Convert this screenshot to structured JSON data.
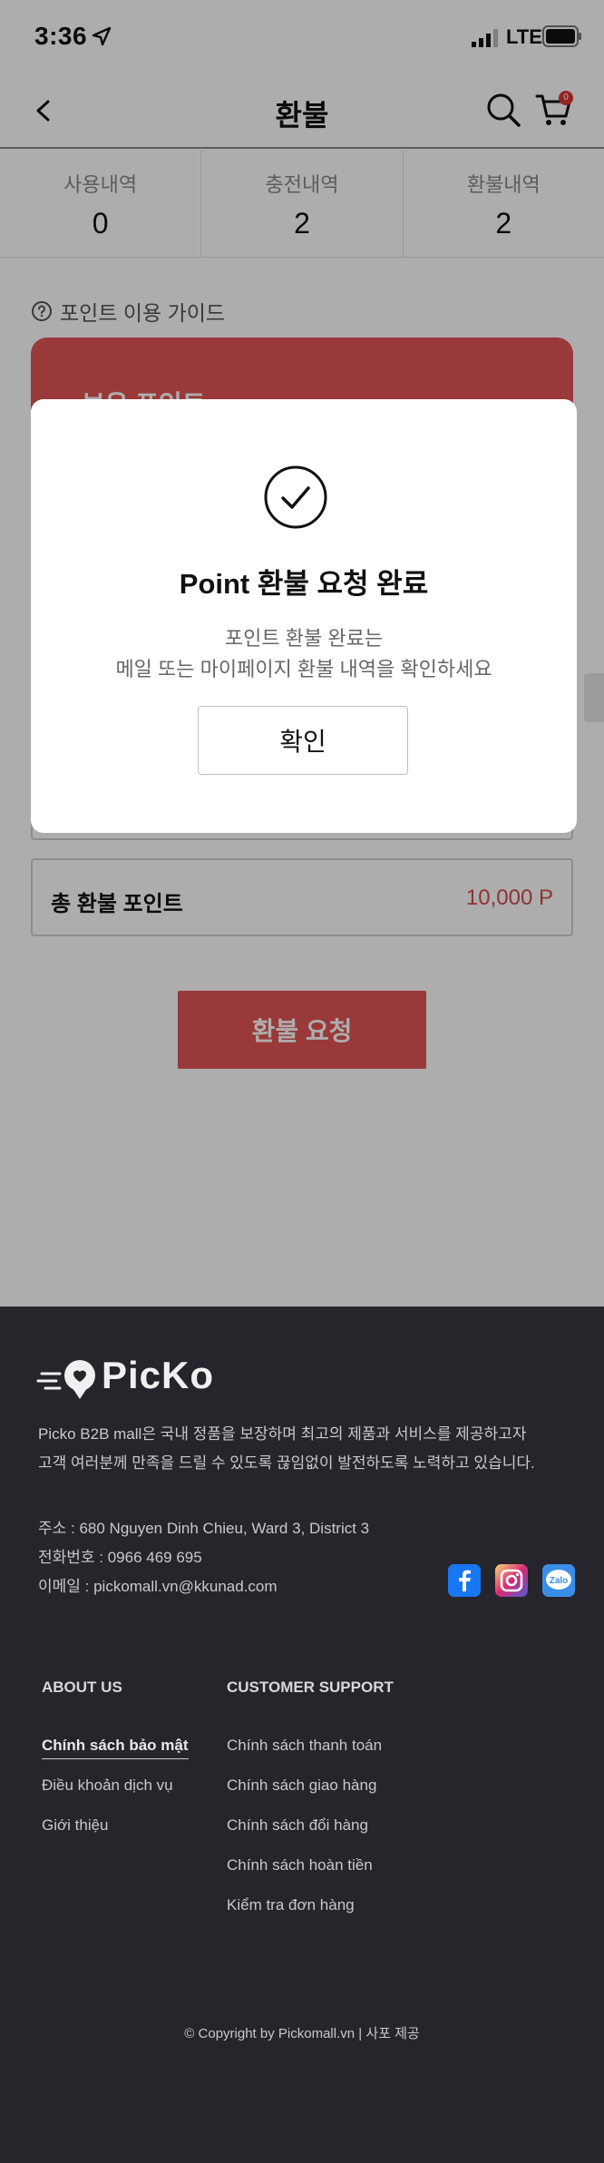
{
  "status_bar": {
    "time": "3:36",
    "network": "LTE"
  },
  "header": {
    "title": "환불",
    "cart_count": "0"
  },
  "stats": [
    {
      "label": "사용내역",
      "value": "0"
    },
    {
      "label": "충전내역",
      "value": "2"
    },
    {
      "label": "환불내역",
      "value": "2"
    }
  ],
  "guide": {
    "label": "포인트 이용 가이드"
  },
  "point_card": {
    "label": "보유 포인트"
  },
  "total": {
    "label": "총 환불 포인트",
    "value": "10,000 P"
  },
  "refund_button": {
    "label": "환불 요청"
  },
  "modal": {
    "title": "Point 환불 요청 완료",
    "message_line1": "포인트 환불 완료는",
    "message_line2": "메일 또는 마이페이지 환불 내역을 확인하세요",
    "confirm_label": "확인"
  },
  "footer": {
    "brand": "PicKo",
    "about_line1": "Picko B2B mall은 국내 정품을 보장하며 최고의 제품과 서비스를 제공하고자",
    "about_line2": "고객 여러분께 만족을 드릴 수 있도록 끊임없이 발전하도록 노력하고 있습니다.",
    "address": "주소 : 680 Nguyen Dinh Chieu, Ward 3, District 3",
    "phone": "전화번호 : 0966 469 695",
    "email": "이메일 : pickomall.vn@kkunad.com",
    "social": {
      "zalo": "Zalo"
    },
    "about_us": {
      "title": "ABOUT US",
      "links": [
        "Chính sách bảo mật",
        "Điều khoản dịch vụ",
        "Giới thiệu"
      ]
    },
    "support": {
      "title": "CUSTOMER SUPPORT",
      "links": [
        "Chính sách thanh toán",
        "Chính sách giao hàng",
        "Chính sách đổi hàng",
        "Chính sách hoàn tiền",
        "Kiểm tra đơn hàng"
      ]
    },
    "copyright": "© Copyright by Pickomall.vn | 사포 제공"
  },
  "colors": {
    "accent": "#e35454",
    "footer_bg": "#26252b",
    "price": "#d84a4a"
  },
  "icons": [
    "location-arrow-icon",
    "signal-icon",
    "battery-icon",
    "back-chevron-icon",
    "search-icon",
    "cart-icon",
    "help-circle-icon",
    "check-circle-icon",
    "facebook-icon",
    "instagram-icon",
    "zalo-icon"
  ]
}
